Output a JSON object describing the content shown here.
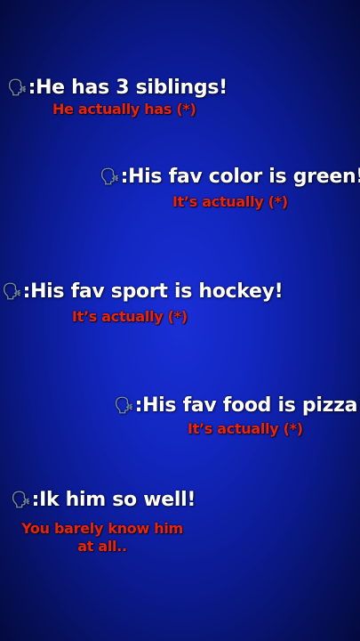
{
  "claims": [
    {
      "icon": "speaking-head-icon",
      "text": "He has 3 siblings!",
      "correction": "He actually has (*)"
    },
    {
      "icon": "speaking-head-icon",
      "text": "His fav color is green!",
      "correction": "It’s actually (*)"
    },
    {
      "icon": "speaking-head-icon",
      "text": "His fav sport is hockey!",
      "correction": "It’s actually (*)"
    },
    {
      "icon": "speaking-head-icon",
      "text": "His fav food is pizza!",
      "correction": "It’s actually (*)"
    },
    {
      "icon": "speaking-head-icon",
      "text": "Ik him so well!",
      "correction": "You barely know him at all.."
    }
  ],
  "colors": {
    "claim_text": "#ffffff",
    "correction_text": "#e8240f",
    "background": "#1226bf"
  }
}
